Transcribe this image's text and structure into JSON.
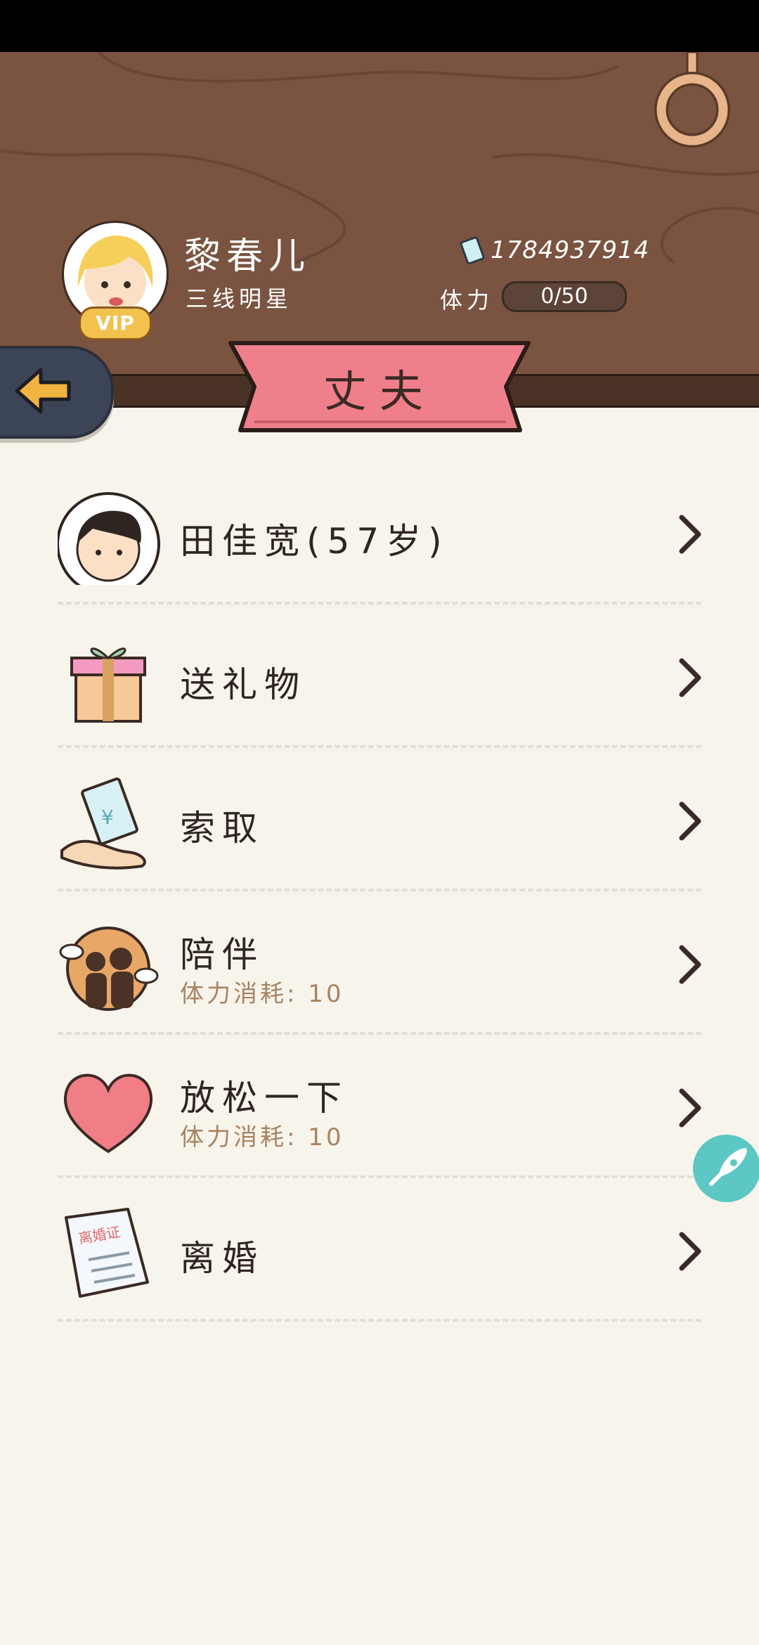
{
  "profile": {
    "name": "黎春儿",
    "title": "三线明星",
    "vip_label": "VIP",
    "money": "1784937914",
    "stamina_label": "体力",
    "stamina_value": "0/50"
  },
  "banner": {
    "title": "丈夫"
  },
  "menu": [
    {
      "label": "田佳宽(57岁)",
      "sub": "",
      "icon": "husband-avatar-icon"
    },
    {
      "label": "送礼物",
      "sub": "",
      "icon": "gift-icon"
    },
    {
      "label": "索取",
      "sub": "",
      "icon": "money-hand-icon"
    },
    {
      "label": "陪伴",
      "sub": "体力消耗: 10",
      "icon": "couple-icon"
    },
    {
      "label": "放松一下",
      "sub": "体力消耗: 10",
      "icon": "heart-icon"
    },
    {
      "label": "离婚",
      "sub": "",
      "icon": "divorce-certificate-icon"
    }
  ],
  "divorce_icon_text": "离婚证",
  "colors": {
    "wood": "#7a5440",
    "banner_pink": "#ef7f8a",
    "back_button": "#3c4557",
    "accent_orange": "#f2b440",
    "rocket": "#5cc7c3"
  }
}
